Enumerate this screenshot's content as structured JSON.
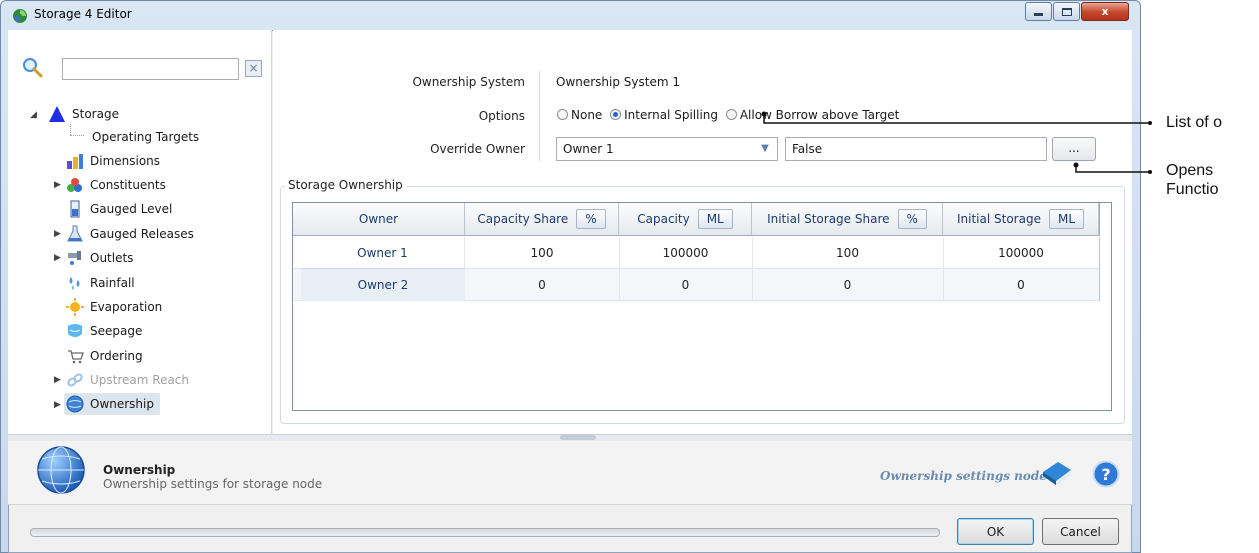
{
  "window": {
    "title": "Storage 4 Editor",
    "close_glyph": "x"
  },
  "tree": {
    "search_placeholder": "",
    "items": [
      {
        "label": "Storage",
        "icon": "triangle-icon"
      },
      {
        "label": "Operating Targets",
        "icon": "none"
      },
      {
        "label": "Dimensions",
        "icon": "dimensions-icon"
      },
      {
        "label": "Constituents",
        "icon": "constituents-icon"
      },
      {
        "label": "Gauged Level",
        "icon": "gauge-icon"
      },
      {
        "label": "Gauged Releases",
        "icon": "flask-icon"
      },
      {
        "label": "Outlets",
        "icon": "outlets-icon"
      },
      {
        "label": "Rainfall",
        "icon": "rain-icon"
      },
      {
        "label": "Evaporation",
        "icon": "sun-icon"
      },
      {
        "label": "Seepage",
        "icon": "seepage-icon"
      },
      {
        "label": "Ordering",
        "icon": "cart-icon"
      },
      {
        "label": "Upstream Reach",
        "icon": "link-icon"
      },
      {
        "label": "Ownership",
        "icon": "globe-icon"
      }
    ]
  },
  "form": {
    "ownership_system_label": "Ownership System",
    "ownership_system_value": "Ownership System 1",
    "options_label": "Options",
    "options": [
      "None",
      "Internal Spilling",
      "Allow Borrow above Target"
    ],
    "options_selected": "Internal Spilling",
    "override_owner_label": "Override Owner",
    "override_owner_value": "Owner 1",
    "function_value": "False",
    "ellipsis_label": "..."
  },
  "ownership": {
    "group_title": "Storage Ownership",
    "columns": [
      {
        "label": "Owner",
        "unit": ""
      },
      {
        "label": "Capacity Share",
        "unit": "%"
      },
      {
        "label": "Capacity",
        "unit": "ML"
      },
      {
        "label": "Initial Storage Share",
        "unit": "%"
      },
      {
        "label": "Initial Storage",
        "unit": "ML"
      }
    ],
    "rows": [
      [
        "Owner 1",
        "100",
        "100000",
        "100",
        "100000"
      ],
      [
        "Owner 2",
        "0",
        "0",
        "0",
        "0"
      ]
    ]
  },
  "info": {
    "title": "Ownership",
    "description": "Ownership settings for storage node",
    "node_label": "Ownership settings node"
  },
  "buttons": {
    "ok": "OK",
    "cancel": "Cancel"
  },
  "callouts": {
    "list_text": "List of o",
    "opens_line1": "Opens",
    "opens_line2": "Functio"
  }
}
